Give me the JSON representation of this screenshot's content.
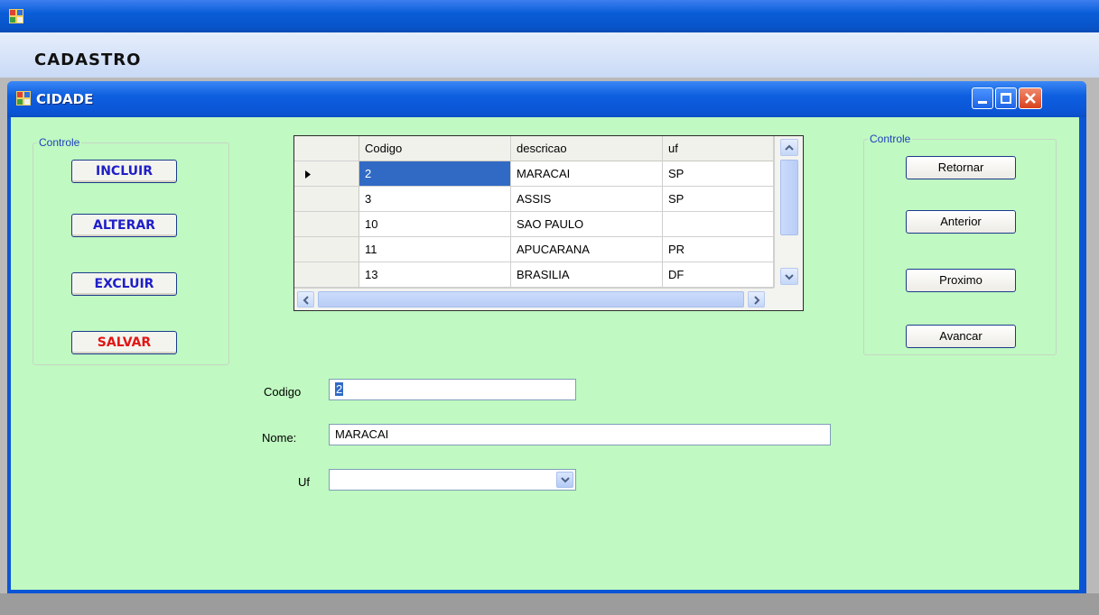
{
  "app": {
    "menu": {
      "cadastro": "CADASTRO"
    }
  },
  "window": {
    "title": "CIDADE"
  },
  "left_group": {
    "legend": "Controle",
    "buttons": [
      {
        "label": "INCLUIR",
        "color": "#1f1fc8"
      },
      {
        "label": "ALTERAR",
        "color": "#1f1fc8"
      },
      {
        "label": "EXCLUIR",
        "color": "#1f1fc8"
      },
      {
        "label": "SALVAR",
        "color": "#e01616"
      }
    ]
  },
  "right_group": {
    "legend": "Controle",
    "buttons": [
      {
        "label": "Retornar"
      },
      {
        "label": "Anterior"
      },
      {
        "label": "Proximo"
      },
      {
        "label": "Avancar"
      }
    ]
  },
  "grid": {
    "columns": [
      "Codigo",
      "descricao",
      "uf"
    ],
    "rows": [
      {
        "codigo": "2",
        "descricao": "MARACAI",
        "uf": "SP",
        "current": true
      },
      {
        "codigo": "3",
        "descricao": "ASSIS",
        "uf": "SP"
      },
      {
        "codigo": "10",
        "descricao": "SAO PAULO",
        "uf": ""
      },
      {
        "codigo": "11",
        "descricao": "APUCARANA",
        "uf": "PR"
      },
      {
        "codigo": "13",
        "descricao": "BRASILIA",
        "uf": "DF"
      }
    ]
  },
  "form": {
    "codigo_label": "Codigo",
    "codigo_value": "2",
    "nome_label": "Nome:",
    "nome_value": "MARACAI",
    "uf_label": "Uf",
    "uf_value": ""
  },
  "colors": {
    "body_bg": "#c0f9c1",
    "titlebar": "#0a55d6",
    "selection": "#316ac5"
  }
}
